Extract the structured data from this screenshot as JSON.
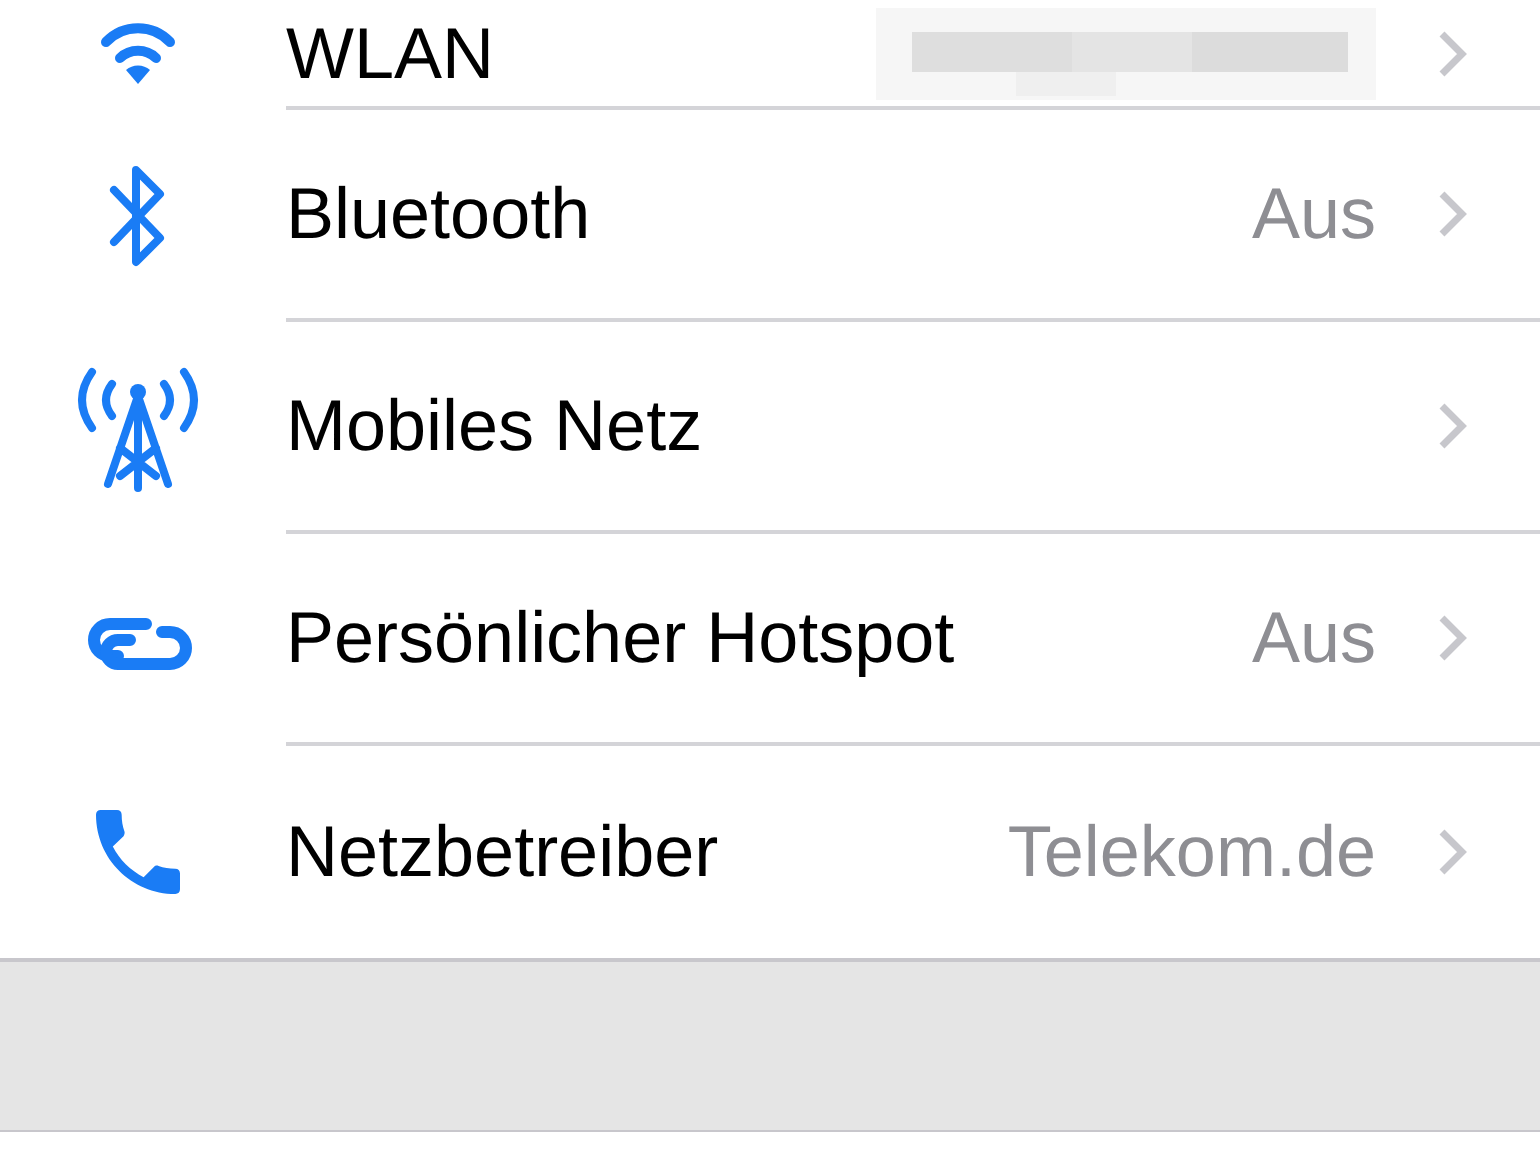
{
  "rows": [
    {
      "kind": "redacted",
      "label": "WLAN"
    },
    {
      "kind": "plain",
      "label": "Bluetooth",
      "value": "Aus"
    },
    {
      "kind": "plain",
      "label": "Mobiles Netz"
    },
    {
      "kind": "plain",
      "label": "Persönlicher Hotspot",
      "value": "Aus"
    },
    {
      "kind": "plain",
      "label": "Netzbetreiber",
      "value": "Telekom.de"
    }
  ]
}
